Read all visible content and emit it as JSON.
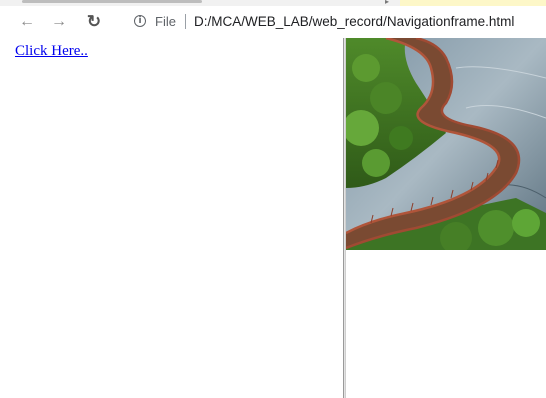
{
  "browser": {
    "back_icon": "back-arrow-icon",
    "forward_icon": "forward-arrow-icon",
    "reload_icon": "reload-icon",
    "info_icon": "info-icon",
    "scheme_label": "File",
    "url": "D:/MCA/WEB_LAB/web_record/Navigationframe.html"
  },
  "left_frame": {
    "link_text": "Click Here.."
  },
  "right_frame": {
    "image_subject": "wooden boardwalk over water with greenery"
  }
}
